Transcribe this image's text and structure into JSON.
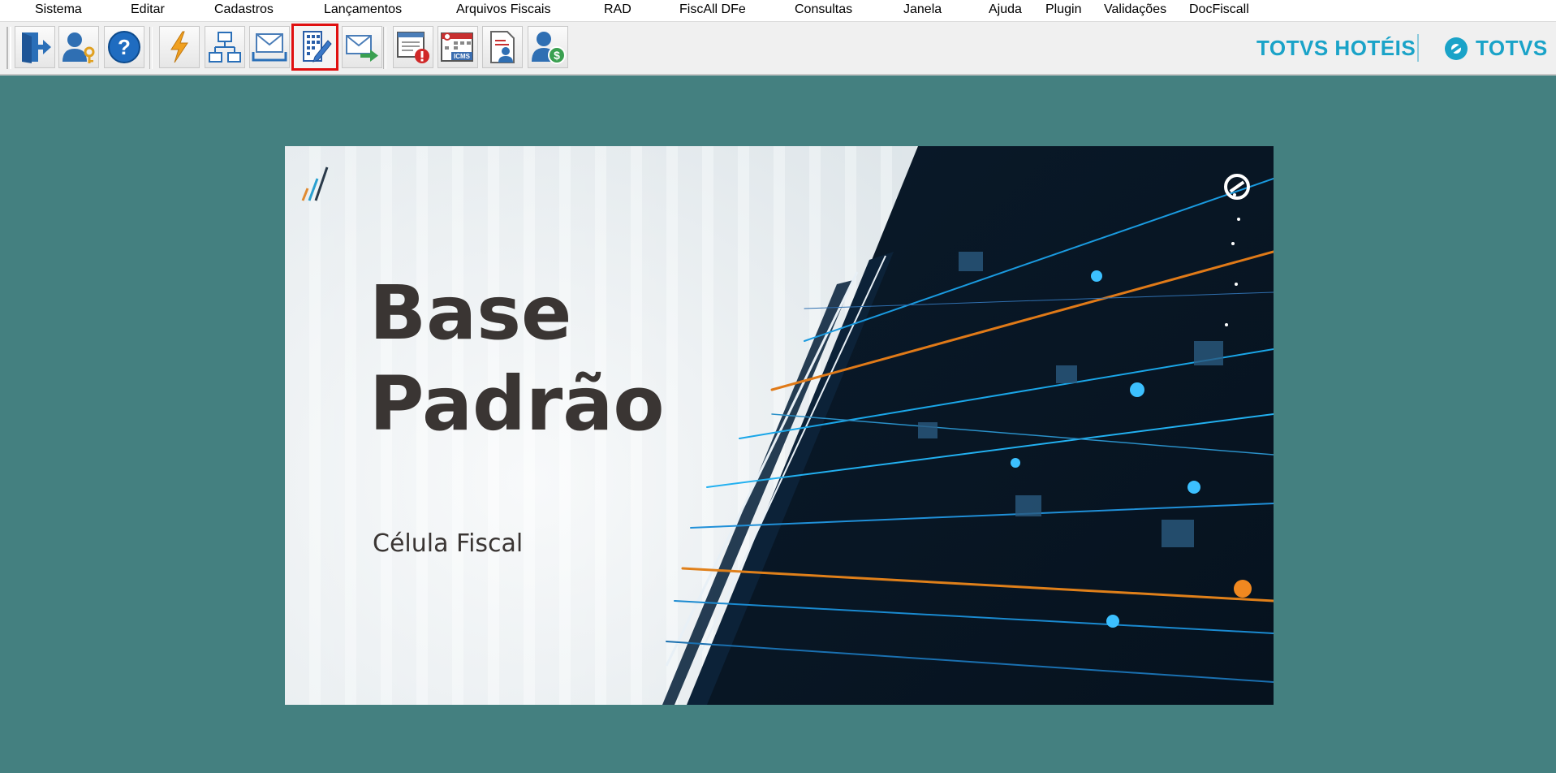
{
  "menu": {
    "items": [
      {
        "label": "Sistema"
      },
      {
        "label": "Editar"
      },
      {
        "label": "Cadastros"
      },
      {
        "label": "Lançamentos"
      },
      {
        "label": "Arquivos Fiscais"
      },
      {
        "label": "RAD"
      },
      {
        "label": "FiscAll DFe"
      },
      {
        "label": "Consultas"
      },
      {
        "label": "Janela"
      },
      {
        "label": "Ajuda"
      },
      {
        "label": "Plugin"
      },
      {
        "label": "Validações"
      },
      {
        "label": "DocFiscall"
      }
    ]
  },
  "toolbar": {
    "buttons": [
      {
        "icon": "exit-door-icon"
      },
      {
        "icon": "user-key-icon"
      },
      {
        "icon": "help-icon"
      },
      {
        "icon": "lightning-icon"
      },
      {
        "icon": "hierarchy-icon"
      },
      {
        "icon": "mail-tray-icon"
      },
      {
        "icon": "edit-building-icon",
        "active": true
      },
      {
        "icon": "mail-send-icon"
      },
      {
        "icon": "window-alert-icon"
      },
      {
        "icon": "calendar-icms-icon",
        "text": "ICMS"
      },
      {
        "icon": "document-user-icon"
      },
      {
        "icon": "user-money-icon",
        "text": "$"
      }
    ],
    "highlight_color": "#e01010"
  },
  "brand": {
    "product": "TOTVS HOTÉIS",
    "company": "TOTVS",
    "color": "#1aa3c8"
  },
  "splash": {
    "title": "Base\nPadrão",
    "subtitle": "Célula Fiscal"
  },
  "colors": {
    "workspace": "#448080"
  }
}
